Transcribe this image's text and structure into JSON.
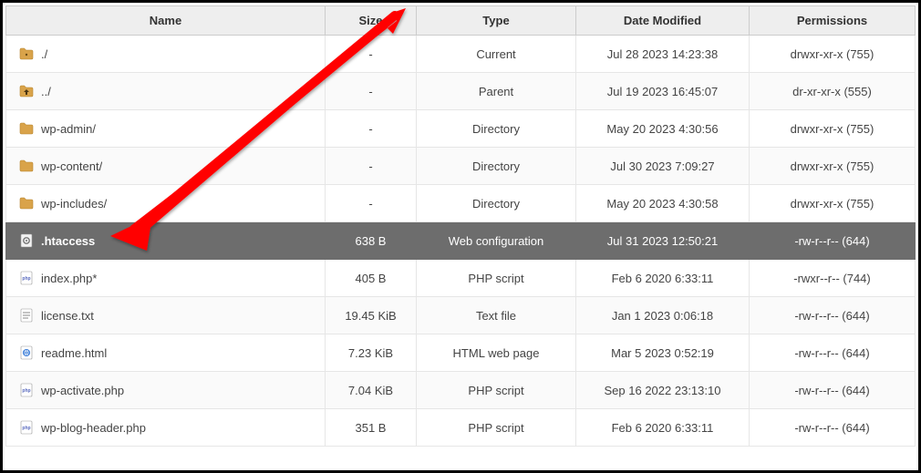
{
  "columns": {
    "name": "Name",
    "size": "Size",
    "type": "Type",
    "date": "Date Modified",
    "perm": "Permissions"
  },
  "rows": [
    {
      "icon": "folder-dot",
      "name": "./",
      "size": "-",
      "type": "Current",
      "date": "Jul 28 2023 14:23:38",
      "perm": "drwxr-xr-x (755)",
      "selected": false
    },
    {
      "icon": "folder-up",
      "name": "../",
      "size": "-",
      "type": "Parent",
      "date": "Jul 19 2023 16:45:07",
      "perm": "dr-xr-xr-x (555)",
      "selected": false
    },
    {
      "icon": "folder",
      "name": "wp-admin/",
      "size": "-",
      "type": "Directory",
      "date": "May 20 2023 4:30:56",
      "perm": "drwxr-xr-x (755)",
      "selected": false
    },
    {
      "icon": "folder",
      "name": "wp-content/",
      "size": "-",
      "type": "Directory",
      "date": "Jul 30 2023 7:09:27",
      "perm": "drwxr-xr-x (755)",
      "selected": false
    },
    {
      "icon": "folder",
      "name": "wp-includes/",
      "size": "-",
      "type": "Directory",
      "date": "May 20 2023 4:30:58",
      "perm": "drwxr-xr-x (755)",
      "selected": false
    },
    {
      "icon": "gear-file",
      "name": ".htaccess",
      "size": "638 B",
      "type": "Web configuration",
      "date": "Jul 31 2023 12:50:21",
      "perm": "-rw-r--r-- (644)",
      "selected": true
    },
    {
      "icon": "php",
      "name": "index.php*",
      "size": "405 B",
      "type": "PHP script",
      "date": "Feb 6 2020 6:33:11",
      "perm": "-rwxr--r-- (744)",
      "selected": false
    },
    {
      "icon": "text",
      "name": "license.txt",
      "size": "19.45 KiB",
      "type": "Text file",
      "date": "Jan 1 2023 0:06:18",
      "perm": "-rw-r--r-- (644)",
      "selected": false
    },
    {
      "icon": "html",
      "name": "readme.html",
      "size": "7.23 KiB",
      "type": "HTML web page",
      "date": "Mar 5 2023 0:52:19",
      "perm": "-rw-r--r-- (644)",
      "selected": false
    },
    {
      "icon": "php",
      "name": "wp-activate.php",
      "size": "7.04 KiB",
      "type": "PHP script",
      "date": "Sep 16 2022 23:13:10",
      "perm": "-rw-r--r-- (644)",
      "selected": false
    },
    {
      "icon": "php",
      "name": "wp-blog-header.php",
      "size": "351 B",
      "type": "PHP script",
      "date": "Feb 6 2020 6:33:11",
      "perm": "-rw-r--r-- (644)",
      "selected": false
    }
  ]
}
